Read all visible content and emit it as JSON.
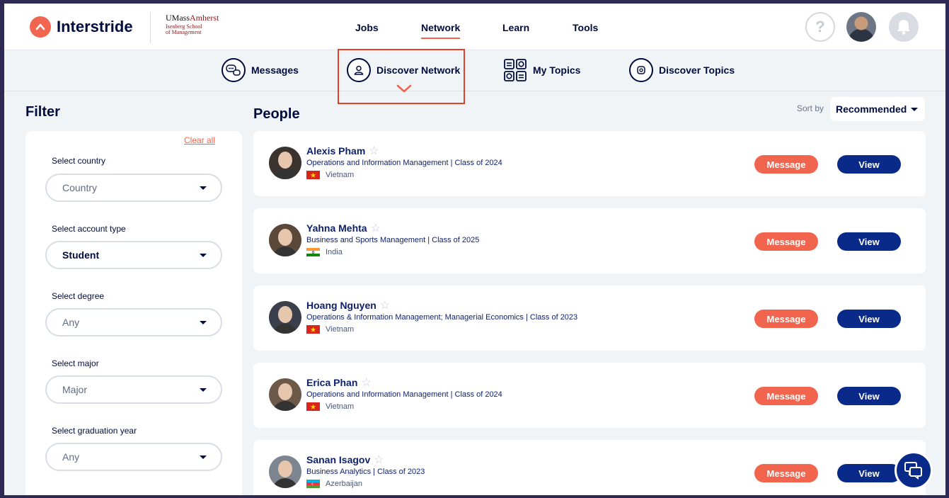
{
  "header": {
    "brand": "Interstride",
    "school_line1": "UMass",
    "school_line1b": "Amherst",
    "school_line2": "Isenberg School",
    "school_line3": "of Management",
    "nav": [
      {
        "label": "Jobs",
        "active": false
      },
      {
        "label": "Network",
        "active": true
      },
      {
        "label": "Learn",
        "active": false
      },
      {
        "label": "Tools",
        "active": false
      }
    ],
    "help_label": "?"
  },
  "subnav": {
    "items": [
      {
        "label": "Messages",
        "icon": "chat-bubbles-icon"
      },
      {
        "label": "Discover Network",
        "icon": "person-search-icon"
      },
      {
        "label": "My Topics",
        "icon": "topics-grid-icon"
      },
      {
        "label": "Discover Topics",
        "icon": "topic-search-icon"
      }
    ]
  },
  "filter": {
    "title": "Filter",
    "clear_all": "Clear all",
    "fields": [
      {
        "label": "Select country",
        "value": "Country",
        "selected": false
      },
      {
        "label": "Select account type",
        "value": "Student",
        "selected": true
      },
      {
        "label": "Select degree",
        "value": "Any",
        "selected": false
      },
      {
        "label": "Select major",
        "value": "Major",
        "selected": false
      },
      {
        "label": "Select graduation year",
        "value": "Any",
        "selected": false
      }
    ]
  },
  "people": {
    "title": "People",
    "sort_label": "Sort by",
    "sort_value": "Recommended",
    "message_label": "Message",
    "view_label": "View",
    "list": [
      {
        "name": "Alexis Pham",
        "desc": "Operations and Information Management | Class of 2024",
        "country": "Vietnam",
        "flag": "vietnam"
      },
      {
        "name": "Yahna Mehta",
        "desc": "Business and Sports Management | Class of 2025",
        "country": "India",
        "flag": "india"
      },
      {
        "name": "Hoang Nguyen",
        "desc": "Operations & Information Management; Managerial Economics | Class of 2023",
        "country": "Vietnam",
        "flag": "vietnam"
      },
      {
        "name": "Erica Phan",
        "desc": "Operations and Information Management | Class of 2024",
        "country": "Vietnam",
        "flag": "vietnam"
      },
      {
        "name": "Sanan Isagov",
        "desc": "Business Analytics | Class of 2023",
        "country": "Azerbaijan",
        "flag": "azerbaijan"
      }
    ]
  },
  "colors": {
    "accent": "#f1644e",
    "primary": "#0a2a8a",
    "text": "#000c3d"
  }
}
